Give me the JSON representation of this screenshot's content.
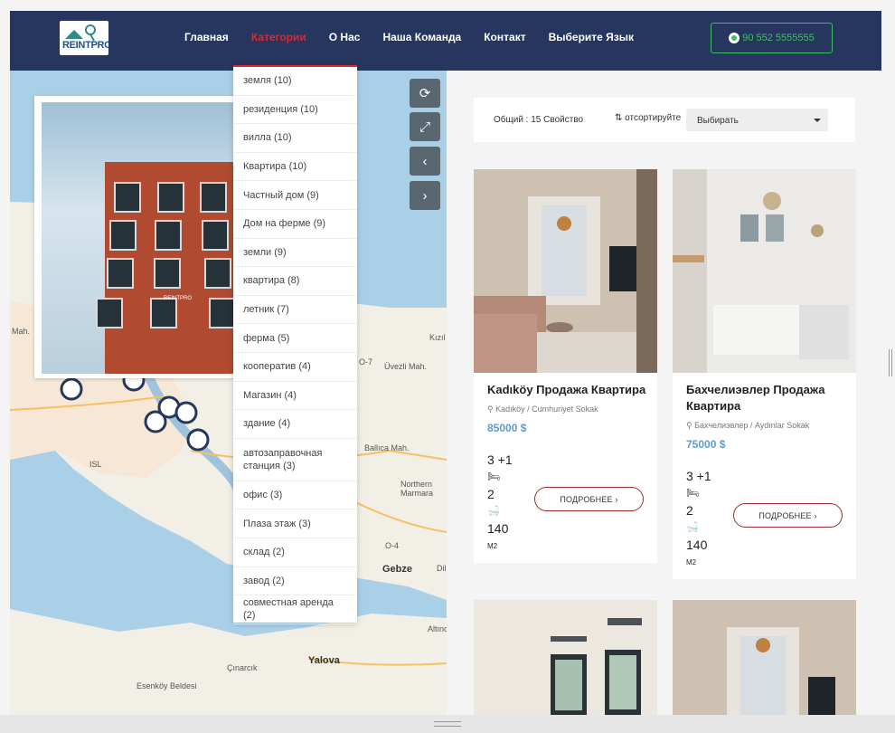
{
  "nav": {
    "logo_text": "REINTPRO",
    "items": [
      {
        "label": "Главная"
      },
      {
        "label": "Категории",
        "active": true
      },
      {
        "label": "О Нас"
      },
      {
        "label": "Наша Команда"
      },
      {
        "label": "Контакт"
      },
      {
        "label": "Выберите Язык"
      }
    ],
    "phone": "90 552 5555555"
  },
  "colors": {
    "nav_bg": "#26365f",
    "accent_red": "#e0262e",
    "phone_green": "#3cc060",
    "price_blue": "#5b9bd5"
  },
  "dropdown": {
    "items": [
      "земля (10)",
      "резиденция (10)",
      "вилла (10)",
      "Квартира (10)",
      "Частный дом (9)",
      "Дом на ферме (9)",
      "земли (9)",
      "квартира (8)",
      "летник (7)",
      "ферма (5)",
      "кооператив (4)",
      "Магазин (4)",
      "здание (4)",
      "автозаправочная станция (3)",
      "офис (3)",
      "Плаза этаж (3)",
      "склад (2)",
      "завод (2)",
      "совместная аренда (2)"
    ]
  },
  "map": {
    "labels": [
      "Mah.",
      "Kızıl",
      "Üvezli Mah.",
      "Ballıca Mah.",
      "Northern Marmara",
      "Gebze",
      "Dil",
      "Altınov",
      "Yalova",
      "Çınarcık",
      "Esenköy Beldesi",
      "ISL",
      "O-7",
      "O-4"
    ],
    "controls": [
      "refresh-icon",
      "fullscreen-icon",
      "chevron-left-icon",
      "chevron-right-icon"
    ],
    "photo_watermark": "REINTPRO"
  },
  "results": {
    "total": "Общий : 15 Свойство",
    "sort_label": "отсортируйте",
    "sort_value": "Выбирать",
    "cards": [
      {
        "title": "Kadıköy Продажа Квартира",
        "address": "Kadıköy / Cumhuriyet Sokak",
        "price": "85000 $",
        "rooms": "3 +1",
        "beds": "2",
        "area": "140",
        "unit": "M2",
        "button": "ПОДРОБНЕЕ ›"
      },
      {
        "title": "Бахчелиэвлер Продажа Квартира",
        "address": "Бахчелиэвлер / Aydınlar Sokak",
        "price": "75000 $",
        "rooms": "3 +1",
        "beds": "2",
        "area": "140",
        "unit": "M2",
        "button": "ПОДРОБНЕЕ ›"
      }
    ]
  }
}
